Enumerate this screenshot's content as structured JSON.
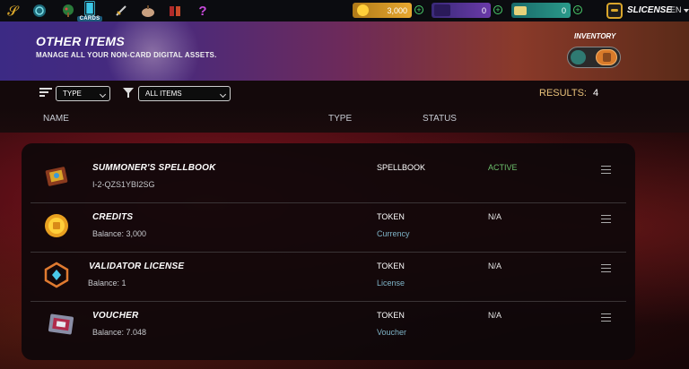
{
  "nav": {
    "cards_label": "CARDS",
    "icons": [
      "logo-icon",
      "orb-icon",
      "tree-icon",
      "cards-icon",
      "sword-icon",
      "pumpkin-icon",
      "battle-icon",
      "question-icon"
    ]
  },
  "currencies": [
    {
      "name": "credits",
      "value": "3,000"
    },
    {
      "name": "sps",
      "value": "0"
    },
    {
      "name": "dec",
      "value": "0"
    }
  ],
  "user": {
    "name": "SLICENSE",
    "language": "EN"
  },
  "banner": {
    "title": "OTHER ITEMS",
    "subtitle": "MANAGE ALL YOUR NON-CARD DIGITAL ASSETS.",
    "inventory_label": "INVENTORY"
  },
  "filters": {
    "type_select": "TYPE",
    "items_select": "ALL ITEMS",
    "results_label": "RESULTS:",
    "results_count": "4"
  },
  "columns": {
    "name": "NAME",
    "type": "TYPE",
    "status": "STATUS"
  },
  "rows": [
    {
      "icon": "spellbook-icon",
      "name": "SUMMONER'S SPELLBOOK",
      "sub": "I-2-QZS1YBI2SG",
      "type": "SPELLBOOK",
      "type_sub": "",
      "status": "ACTIVE"
    },
    {
      "icon": "credits-coin-icon",
      "name": "CREDITS",
      "sub": "Balance: 3,000",
      "type": "TOKEN",
      "type_sub": "Currency",
      "status": "N/A"
    },
    {
      "icon": "validator-license-icon",
      "name": "VALIDATOR LICENSE",
      "sub": "Balance: 1",
      "type": "TOKEN",
      "type_sub": "License",
      "status": "N/A"
    },
    {
      "icon": "voucher-icon",
      "name": "VOUCHER",
      "sub": "Balance: 7.048",
      "type": "TOKEN",
      "type_sub": "Voucher",
      "status": "N/A"
    }
  ],
  "colors": {
    "accent_gold": "#e8c17a",
    "active_green": "#6cc06c",
    "sub_blue": "#7fb4c8"
  }
}
